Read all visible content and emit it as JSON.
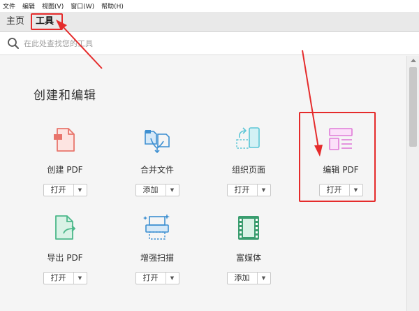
{
  "menubar": {
    "items": [
      "文件",
      "编辑",
      "视图(V)",
      "窗口(W)",
      "帮助(H)"
    ]
  },
  "tabs": [
    {
      "label": "主页",
      "active": false
    },
    {
      "label": "工具",
      "active": true
    }
  ],
  "search": {
    "placeholder": "在此处查找您的工具"
  },
  "section": {
    "title": "创建和编辑"
  },
  "tools": [
    {
      "name": "创建 PDF",
      "button": "打开",
      "icon": "create-pdf-icon"
    },
    {
      "name": "合并文件",
      "button": "添加",
      "icon": "combine-files-icon"
    },
    {
      "name": "组织页面",
      "button": "打开",
      "icon": "organize-pages-icon"
    },
    {
      "name": "编辑 PDF",
      "button": "打开",
      "icon": "edit-pdf-icon"
    },
    {
      "name": "导出 PDF",
      "button": "打开",
      "icon": "export-pdf-icon"
    },
    {
      "name": "增强扫描",
      "button": "打开",
      "icon": "enhance-scan-icon"
    },
    {
      "name": "富媒体",
      "button": "添加",
      "icon": "rich-media-icon"
    }
  ],
  "colors": {
    "annotation_red": "#e52b2b",
    "create_pdf": "#e8756c",
    "combine": "#3d8fd1",
    "organize": "#5cc6d6",
    "edit": "#e07bd8",
    "export": "#4cb88a",
    "scan": "#3d8fd1",
    "media": "#3a9d6f"
  }
}
